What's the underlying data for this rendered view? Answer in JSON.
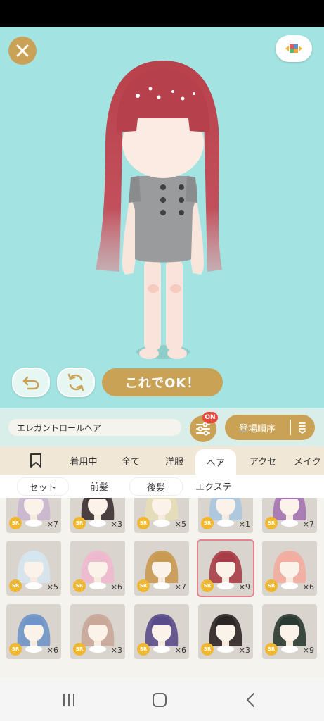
{
  "stage": {
    "ok_label": "これでOK！",
    "item_name": "エレガントロールヘア",
    "filter_badge": "ON",
    "sort_label": "登場順序"
  },
  "tabs": [
    {
      "label": "着用中"
    },
    {
      "label": "全て"
    },
    {
      "label": "洋服"
    },
    {
      "label": "ヘア",
      "active": true
    },
    {
      "label": "アクセ"
    },
    {
      "label": "メイク"
    }
  ],
  "subtabs": [
    {
      "label": "セット"
    },
    {
      "label": "前髪"
    },
    {
      "label": "後髪"
    },
    {
      "label": "エクステ"
    }
  ],
  "grid": {
    "rarity_label": "SR",
    "items": [
      {
        "count": "×7",
        "hair_color": "#c9b6d0"
      },
      {
        "count": "×3",
        "hair_color": "#3a3030"
      },
      {
        "count": "×5",
        "hair_color": "#e6ddb8"
      },
      {
        "count": "×1",
        "hair_color": "#a9c6e0"
      },
      {
        "count": "×7",
        "hair_color": "#a473b3"
      },
      {
        "count": "×5",
        "hair_color": "#d6e6ef"
      },
      {
        "count": "×6",
        "hair_color": "#eeb9cf"
      },
      {
        "count": "×7",
        "hair_color": "#c99a52"
      },
      {
        "count": "×9",
        "hair_color": "#a83d47",
        "selected": true
      },
      {
        "count": "×6",
        "hair_color": "#f2aca0"
      },
      {
        "count": "×6",
        "hair_color": "#6f95c8"
      },
      {
        "count": "×3",
        "hair_color": "#c9a89a"
      },
      {
        "count": "×6",
        "hair_color": "#5a4c8a"
      },
      {
        "count": "×3",
        "hair_color": "#2b2525"
      },
      {
        "count": "×9",
        "hair_color": "#2a3a32"
      }
    ]
  }
}
